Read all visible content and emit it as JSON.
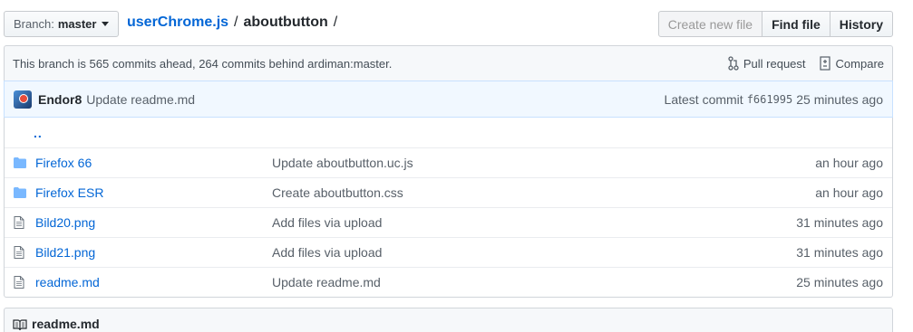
{
  "branch": {
    "label": "Branch:",
    "value": "master"
  },
  "breadcrumb": {
    "repo": "userChrome.js",
    "sep1": "/",
    "current": "aboutbutton",
    "sep2": "/"
  },
  "actions": {
    "create": "Create new file",
    "find": "Find file",
    "history": "History"
  },
  "branch_info": {
    "message": "This branch is 565 commits ahead, 264 commits behind ardiman:master.",
    "pull_request": "Pull request",
    "compare": "Compare"
  },
  "latest_commit": {
    "author": "Endor8",
    "message": "Update readme.md",
    "label": "Latest commit",
    "sha": "f661995",
    "age": "25 minutes ago"
  },
  "up_link": "..",
  "files": [
    {
      "name": "Firefox 66",
      "type": "folder",
      "message": "Update aboutbutton.uc.js",
      "age": "an hour ago"
    },
    {
      "name": "Firefox ESR",
      "type": "folder",
      "message": "Create aboutbutton.css",
      "age": "an hour ago"
    },
    {
      "name": "Bild20.png",
      "type": "file",
      "message": "Add files via upload",
      "age": "31 minutes ago"
    },
    {
      "name": "Bild21.png",
      "type": "file",
      "message": "Add files via upload",
      "age": "31 minutes ago"
    },
    {
      "name": "readme.md",
      "type": "file",
      "message": "Update readme.md",
      "age": "25 minutes ago"
    }
  ],
  "readme": {
    "title": "readme.md"
  },
  "colors": {
    "link": "#0366d6",
    "folder": "#79b8ff",
    "commit_bg": "#f1f8ff"
  }
}
